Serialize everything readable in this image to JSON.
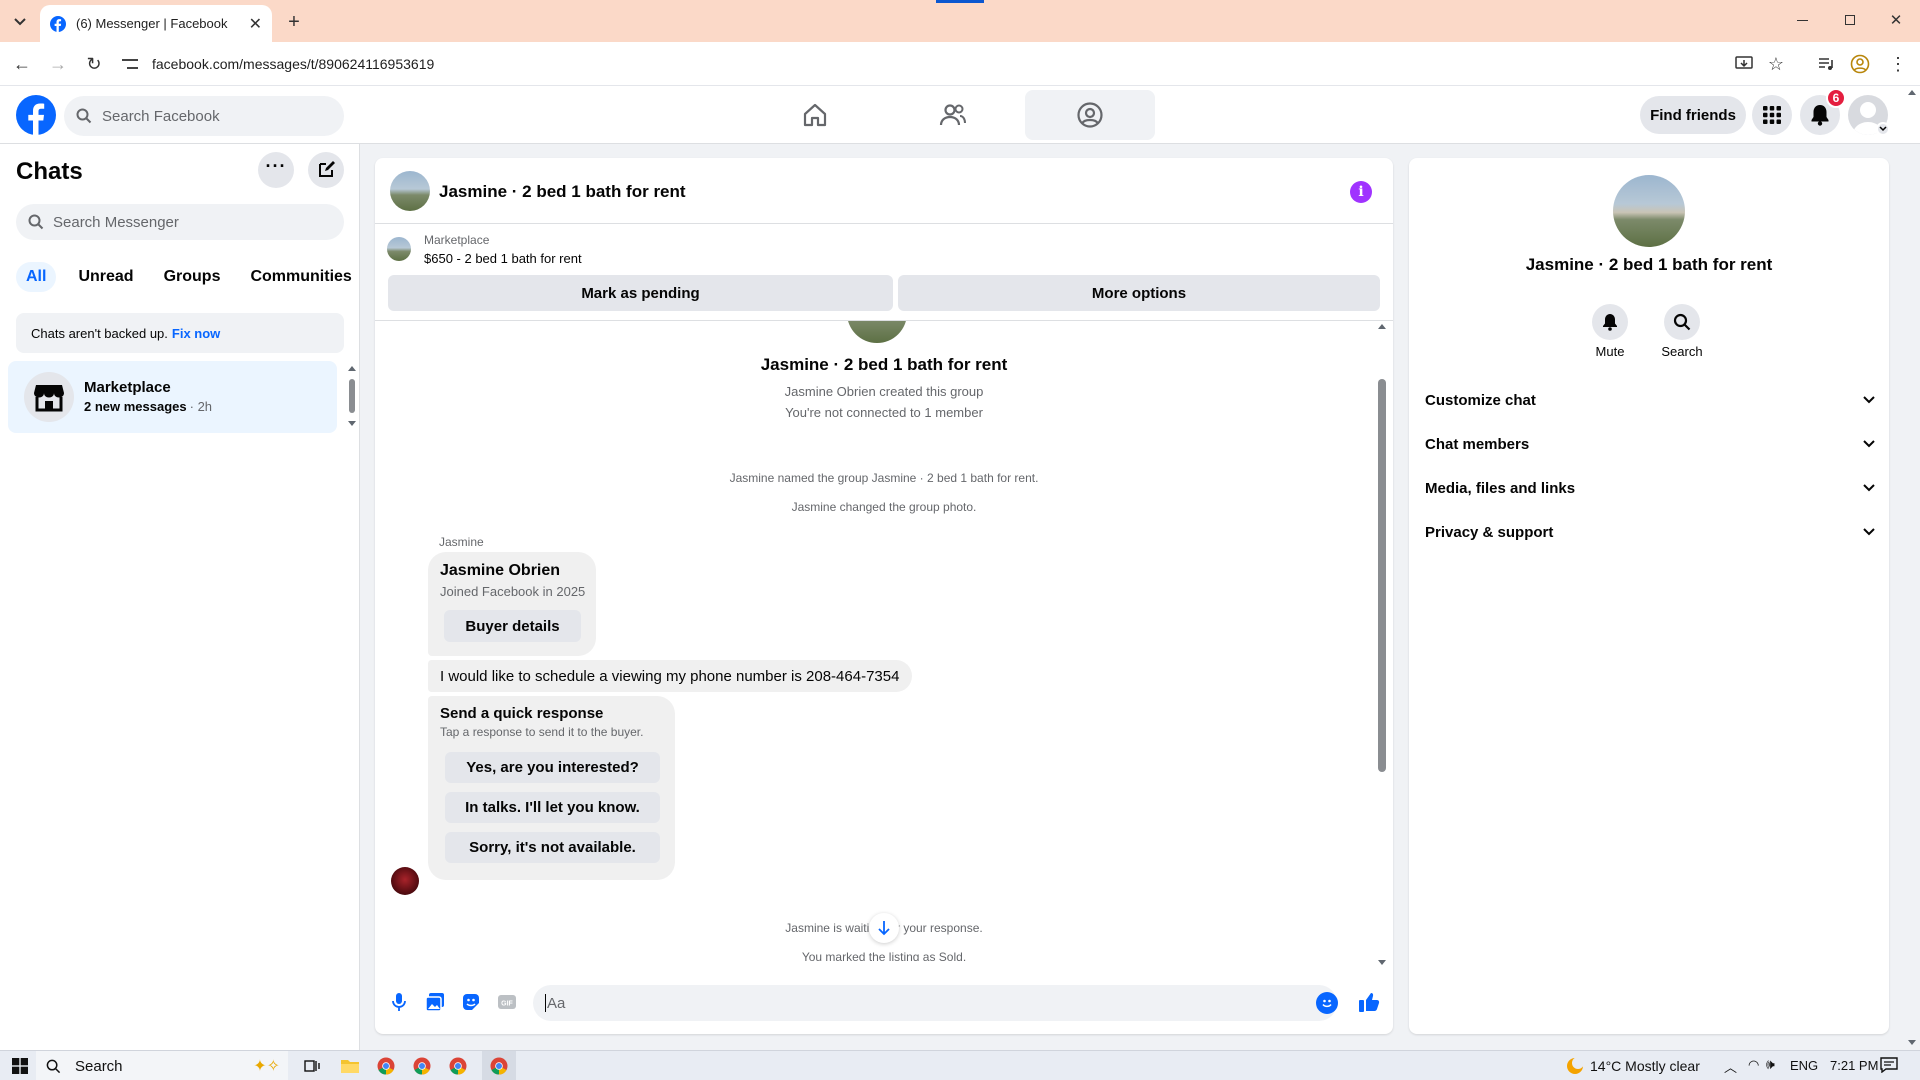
{
  "browser": {
    "tab_title": "(6) Messenger | Facebook",
    "url": "facebook.com/messages/t/890624116953619"
  },
  "header": {
    "search_placeholder": "Search Facebook",
    "find_friends": "Find friends",
    "notification_count": "6"
  },
  "sidebar": {
    "title": "Chats",
    "search_placeholder": "Search Messenger",
    "filters": [
      "All",
      "Unread",
      "Groups",
      "Communities"
    ],
    "backup_text": "Chats aren't backed up.",
    "backup_link": "Fix now",
    "chats": [
      {
        "name": "Marketplace",
        "preview": "2 new messages",
        "time": "· 2h"
      }
    ]
  },
  "chat": {
    "title": "Jasmine · 2 bed 1 bath for rent",
    "listing_source": "Marketplace",
    "listing_title": "$650 - 2 bed 1 bath for rent",
    "mark_pending": "Mark as pending",
    "more_options": "More options",
    "group_name": "Jasmine · 2 bed 1 bath for rent",
    "created_text": "Jasmine Obrien created this group",
    "connected_text": "You're not connected to 1 member",
    "named_text": "Jasmine named the group Jasmine · 2 bed 1 bath for rent.",
    "photo_text": "Jasmine changed the group photo.",
    "sender": "Jasmine",
    "card_name": "Jasmine Obrien",
    "card_sub": "Joined Facebook in 2025",
    "buyer_details": "Buyer details",
    "message": "I would like to schedule a viewing my phone number is 208-464-7354",
    "quick_title": "Send a quick response",
    "quick_sub": "Tap a response to send it to the buyer.",
    "quick_responses": [
      "Yes, are you interested?",
      "In talks. I'll let you know.",
      "Sorry, it's not available."
    ],
    "waiting_text": "Jasmine is waiting for your response.",
    "sold_text": "You marked the listing as Sold.",
    "composer_placeholder": "Aa"
  },
  "info": {
    "title": "Jasmine · 2 bed 1 bath for rent",
    "mute": "Mute",
    "search": "Search",
    "sections": [
      "Customize chat",
      "Chat members",
      "Media, files and links",
      "Privacy & support"
    ]
  },
  "taskbar": {
    "search": "Search",
    "weather": "14°C  Mostly clear",
    "lang": "ENG",
    "time": "7:21 PM"
  },
  "colors": {
    "brand": "#0866ff",
    "accent_purple": "#a033ff",
    "tab_bg": "#fbd9c8",
    "notification_red": "#e41e3f"
  }
}
